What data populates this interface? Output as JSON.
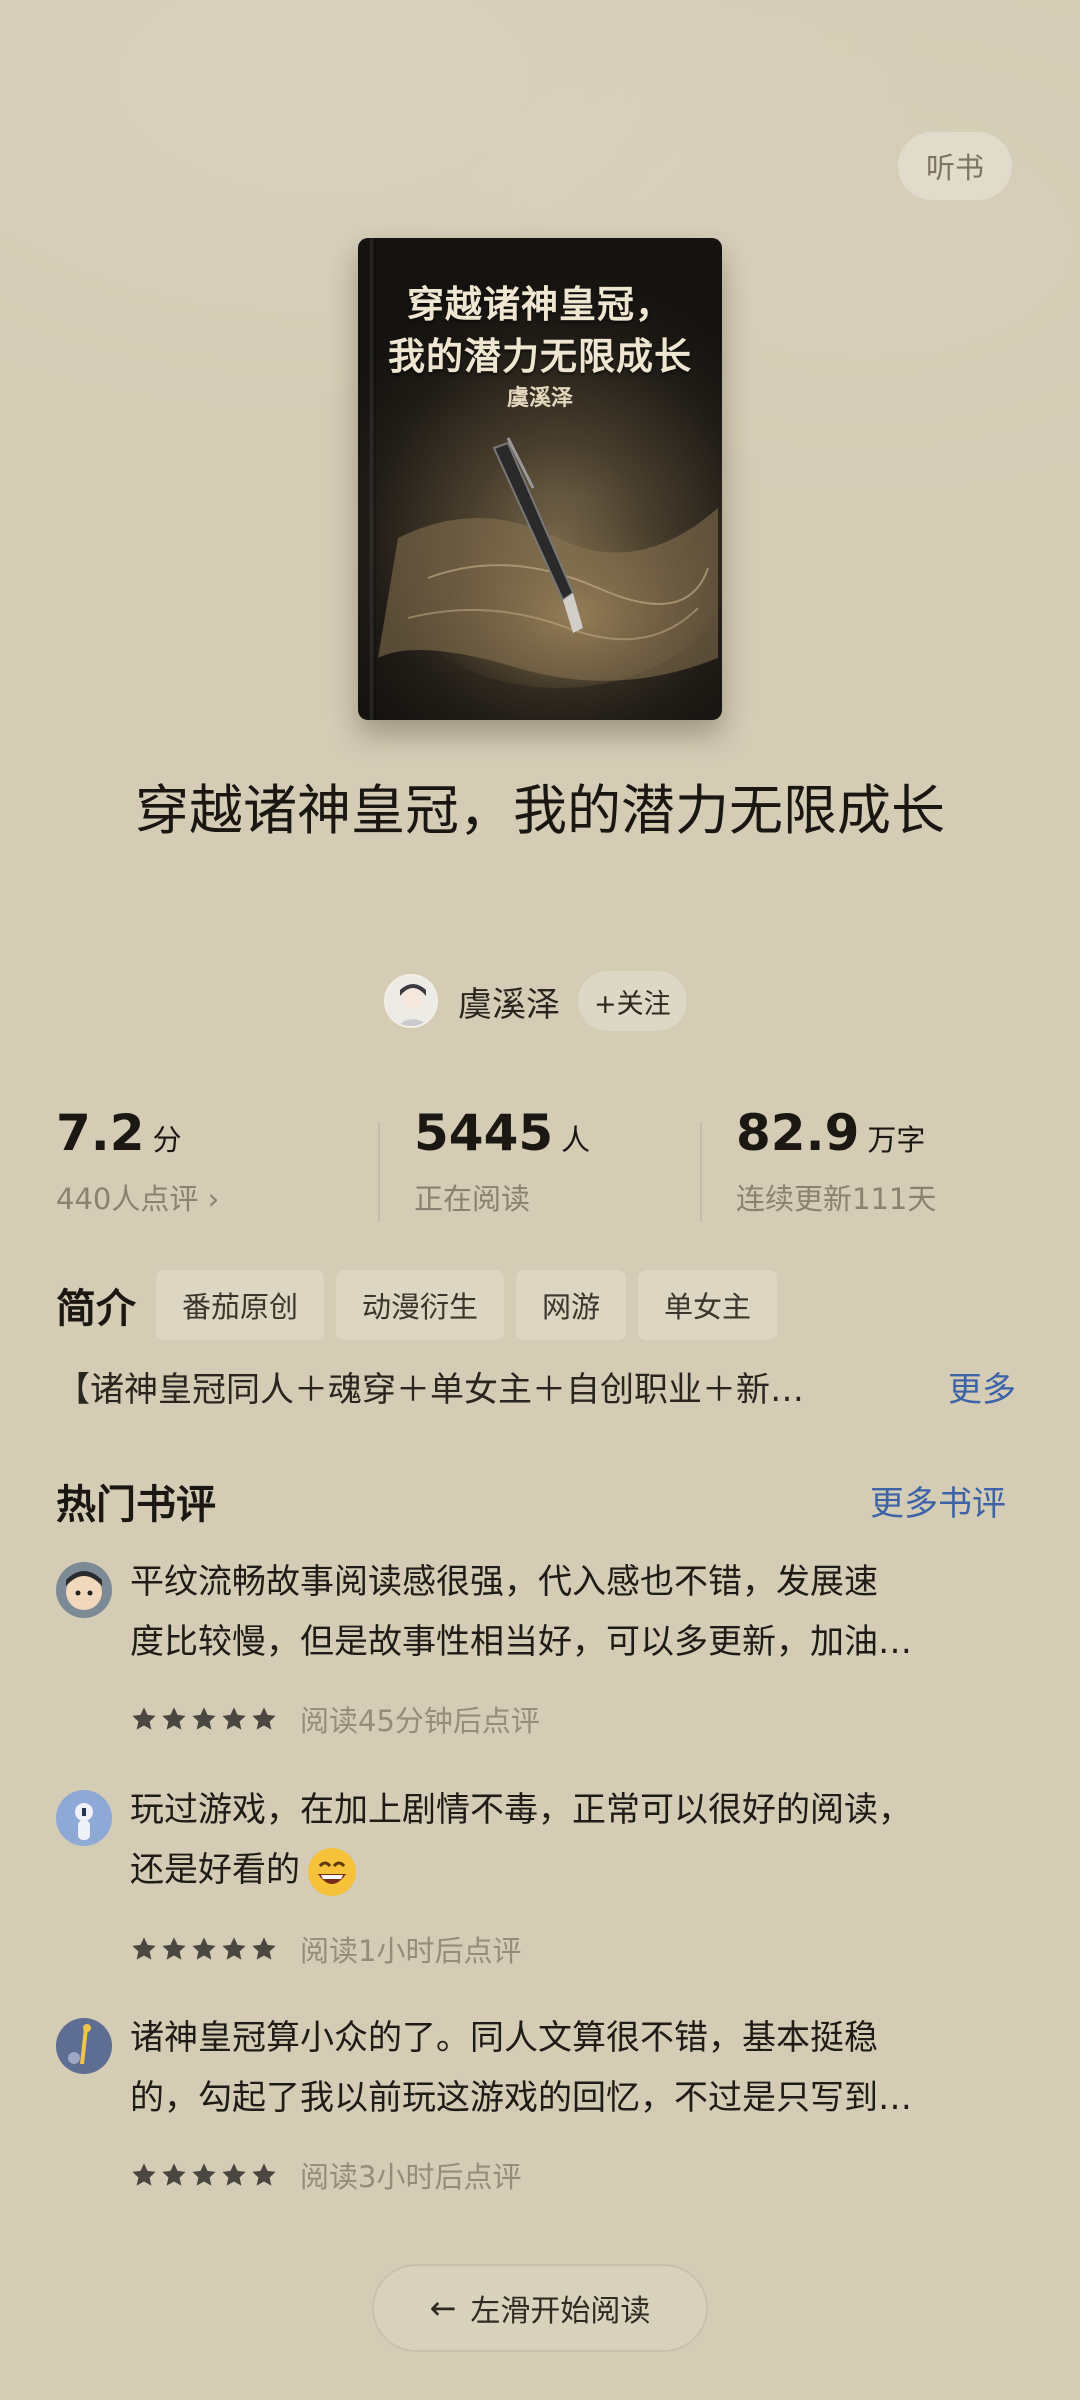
{
  "header": {
    "listen_label": "听书"
  },
  "cover": {
    "title_line1": "穿越诸神皇冠，",
    "title_line2": "我的潜力无限成长",
    "author": "虞溪泽"
  },
  "book": {
    "title": "穿越诸神皇冠，我的潜力无限成长",
    "author": "虞溪泽",
    "follow_label": "+关注"
  },
  "stats": {
    "score": {
      "value": "7.2",
      "unit": "分",
      "sub": "440人点评 ›"
    },
    "readers": {
      "value": "5445",
      "unit": "人",
      "sub": "正在阅读"
    },
    "words": {
      "value": "82.9",
      "unit": "万字",
      "sub": "连续更新111天"
    }
  },
  "intro": {
    "label": "简介",
    "tags": [
      "番茄原创",
      "动漫衍生",
      "网游",
      "单女主"
    ],
    "text": "【诸神皇冠同人＋魂穿＋单女主＋自创职业＋新…",
    "more_label": "更多"
  },
  "reviews_section": {
    "title": "热门书评",
    "more_label": "更多书评"
  },
  "reviews": [
    {
      "line1": "平纹流畅故事阅读感很强，代入感也不错，发展速",
      "line2": "度比较慢，但是故事性相当好，可以多更新，加油…",
      "stars": 5,
      "when": "阅读45分钟后点评",
      "avatar_icon": "cartoon-avatar-icon"
    },
    {
      "line1": "玩过游戏，在加上剧情不毒，正常可以很好的阅读，",
      "line2": "还是好看的",
      "stars": 5,
      "when": "阅读1小时后点评",
      "avatar_icon": "blue-avatar-icon",
      "emoji": "grinning-face-icon"
    },
    {
      "line1": "诸神皇冠算小众的了。同人文算很不错，基本挺稳",
      "line2": "的，勾起了我以前玩这游戏的回忆，不过是只写到…",
      "stars": 5,
      "when": "阅读3小时后点评",
      "avatar_icon": "night-avatar-icon"
    }
  ],
  "footer": {
    "swipe_label": "左滑开始阅读"
  },
  "colors": {
    "background": "#d4ccb5",
    "link": "#3c62a8",
    "muted": "#8a8270"
  }
}
